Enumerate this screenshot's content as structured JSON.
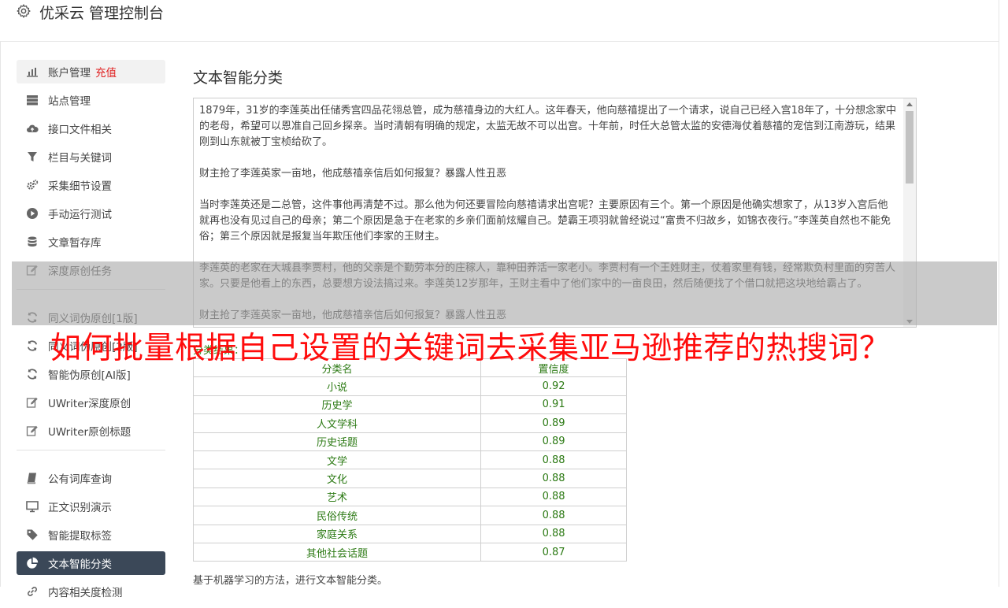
{
  "header": {
    "title": "优采云 管理控制台",
    "icon": "gear-icon"
  },
  "sidebar": {
    "groups": [
      [
        {
          "label": "账户管理",
          "badge": "充值",
          "icon": "bar-chart-icon"
        },
        {
          "label": "站点管理",
          "icon": "server-icon"
        },
        {
          "label": "接口文件相关",
          "icon": "cloud-upload-icon"
        },
        {
          "label": "栏目与关键词",
          "icon": "filter-icon"
        },
        {
          "label": "采集细节设置",
          "icon": "cogs-icon"
        },
        {
          "label": "手动运行测试",
          "icon": "play-circle-icon"
        },
        {
          "label": "文章暂存库",
          "icon": "database-icon"
        },
        {
          "label": "深度原创任务",
          "icon": "edit-icon"
        }
      ],
      [
        {
          "label": "同义词伪原创[1版]",
          "icon": "refresh-icon"
        },
        {
          "label": "同义词伪原创[2版]",
          "icon": "refresh-icon"
        },
        {
          "label": "智能伪原创[AI版]",
          "icon": "refresh-icon"
        },
        {
          "label": "UWriter深度原创",
          "icon": "edit-icon"
        },
        {
          "label": "UWriter原创标题",
          "icon": "edit-icon"
        }
      ],
      [
        {
          "label": "公有词库查询",
          "icon": "book-icon"
        },
        {
          "label": "正文识别演示",
          "icon": "monitor-icon"
        },
        {
          "label": "智能提取标签",
          "icon": "tag-icon"
        },
        {
          "label": "文本智能分类",
          "icon": "pie-chart-icon",
          "active": true
        },
        {
          "label": "内容相关度检测",
          "icon": "link-icon"
        }
      ]
    ]
  },
  "main": {
    "title": "文本智能分类",
    "paragraphs": [
      "1879年，31岁的李莲英出任储秀宫四品花翎总管，成为慈禧身边的大红人。这年春天，他向慈禧提出了一个请求，说自己已经入宫18年了，十分想念家中的老母，希望可以恩准自己回乡探亲。当时清朝有明确的规定，太监无故不可以出宫。十年前，时任大总管太监的安德海仗着慈禧的宠信到江南游玩，结果刚到山东就被丁宝桢给砍了。",
      "财主抢了李莲英家一亩地，他成慈禧亲信后如何报复？暴露人性丑恶",
      "当时李莲英还是二总管，这件事他再清楚不过。那么他为何还要冒险向慈禧请求出宫呢？主要原因有三个。第一个原因是他确实想家了，从13岁入宫后他就再也没有见过自己的母亲；第二个原因是急于在老家的乡亲们面前炫耀自己。楚霸王项羽就曾经说过“富贵不归故乡，如锦衣夜行。”李莲英自然也不能免俗；第三个原因就是报复当年欺压他们李家的王财主。",
      "李莲英的老家在大城县李贾村，他的父亲是个勤劳本分的庄稼人，靠种田养活一家老小。李贾村有一个王姓财主，仗着家里有钱，经常欺负村里面的穷苦人家。只要是他看上的东西，总要想方设法搞过来。李莲英12岁那年，王财主看中了他们家中的一亩良田，然后随便找了个借口就把这块地给霸占了。",
      "财主抢了李莲英家一亩地，他成慈禧亲信后如何报复？暴露人性丑恶"
    ],
    "result_label": "分类结果：",
    "table": {
      "headers": [
        "分类名",
        "置信度"
      ],
      "rows": [
        [
          "小说",
          "0.92"
        ],
        [
          "历史学",
          "0.91"
        ],
        [
          "人文学科",
          "0.89"
        ],
        [
          "历史话题",
          "0.89"
        ],
        [
          "文学",
          "0.88"
        ],
        [
          "文化",
          "0.88"
        ],
        [
          "艺术",
          "0.88"
        ],
        [
          "民俗传统",
          "0.88"
        ],
        [
          "家庭关系",
          "0.88"
        ],
        [
          "其他社会话题",
          "0.87"
        ]
      ]
    },
    "footer": "基于机器学习的方法，进行文本智能分类。"
  },
  "overlay": {
    "headline": "如何批量根据自己设置的关键词去采集亚马逊推荐的热搜词？",
    "color": "#ff0c0c"
  },
  "colors": {
    "active_nav": "#3b4858",
    "accent_red": "#e02020",
    "result_green": "#2c7a14"
  }
}
